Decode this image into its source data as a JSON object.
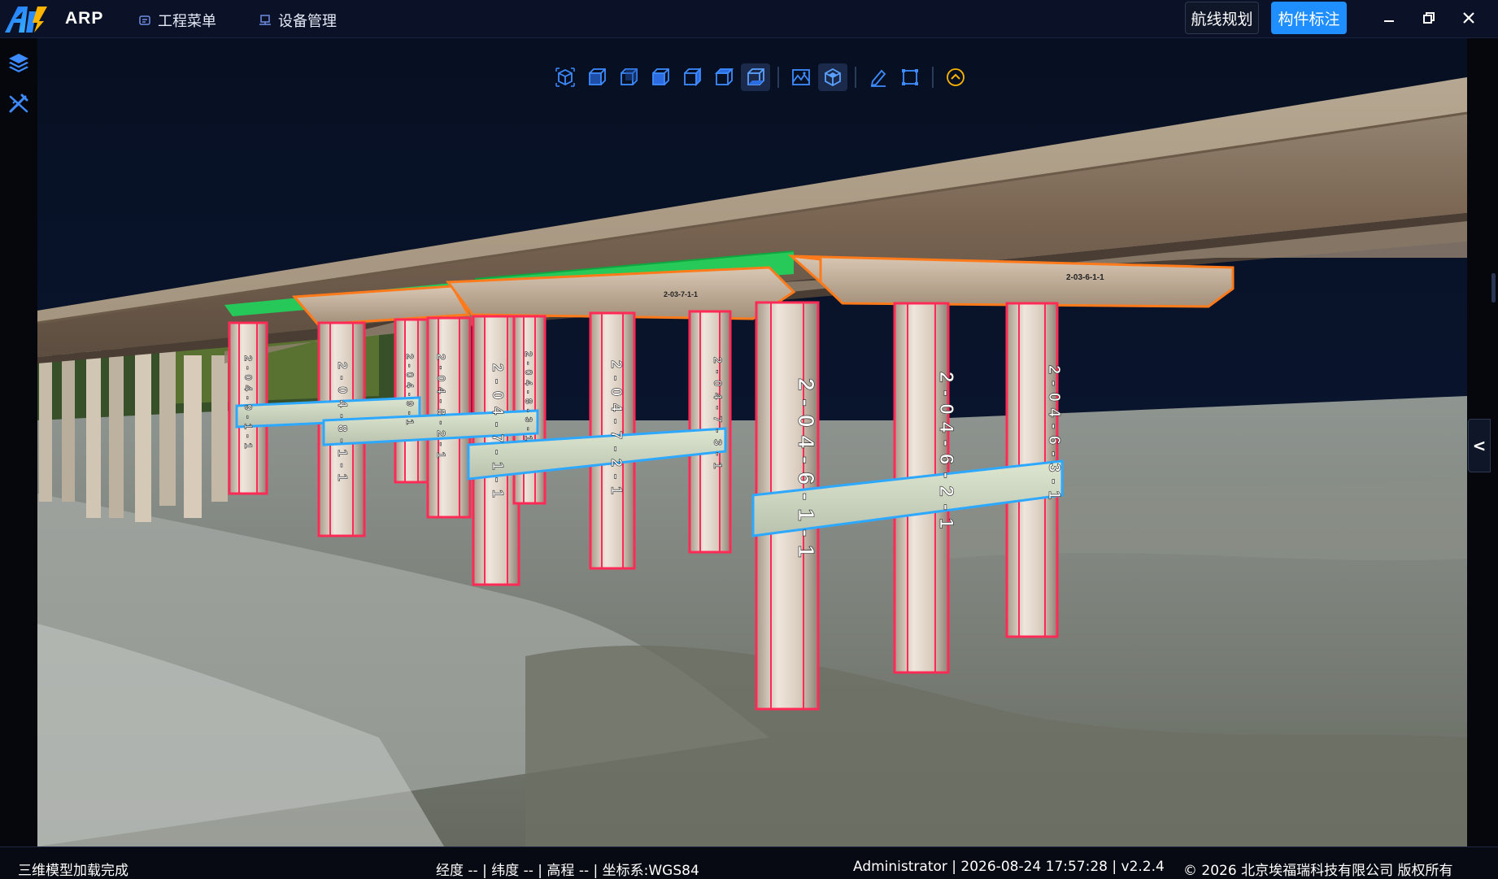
{
  "app": {
    "name": "ARP"
  },
  "menu": {
    "project": "工程菜单",
    "device": "设备管理"
  },
  "header_buttons": {
    "route_planning": "航线规划",
    "component_annotation": "构件标注"
  },
  "icons": {
    "left_rail": [
      "layers-icon",
      "measure-tools-icon"
    ],
    "view_toolbar": [
      "view-iso-icon",
      "view-front-icon",
      "view-back-icon",
      "view-left-icon",
      "view-right-icon",
      "view-top-icon",
      "view-bottom-icon",
      "terrain-icon",
      "model-icon",
      "edit-icon",
      "bounding-box-icon",
      "chevron-up-icon"
    ]
  },
  "view_toolbar": {
    "active": [
      "view-bottom-icon",
      "model-icon"
    ]
  },
  "colors": {
    "accent": "#1f8fff",
    "pier_outline": "#ff2a55",
    "cap_outline": "#ff7a1a",
    "beam_outline": "#2da8ff",
    "deck_fill": "#1fd65b"
  },
  "scene": {
    "pier_labels": [
      "2-04-9-1-1",
      "2-04-8-1-1",
      "2-04-9-1",
      "2-04-8-2-1",
      "2-04-7-1-1",
      "2-04-8-3-1",
      "2-04-7-2-1",
      "2-04-7-3-1",
      "2-04-6-1-1",
      "2-04-6-2-1",
      "2-04-6-3-1"
    ],
    "cap_labels": [
      "2-03-6-1-1",
      "2-03-7-1-1"
    ]
  },
  "status": {
    "message": "三维模型加载完成",
    "coords": "经度 -- | 纬度 -- | 高程 -- | 坐标系:WGS84",
    "user": "Administrator | 2026-08-24 17:57:28 | v2.2.4",
    "copyright": "© 2026 北京埃福瑞科技有限公司 版权所有"
  },
  "panel": {
    "collapse_glyph": "<"
  }
}
